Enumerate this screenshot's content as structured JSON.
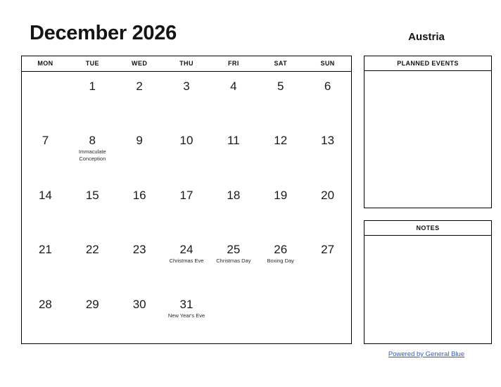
{
  "header": {
    "title": "December 2026",
    "country": "Austria"
  },
  "calendar": {
    "weekdays": [
      "MON",
      "TUE",
      "WED",
      "THU",
      "FRI",
      "SAT",
      "SUN"
    ],
    "weeks": [
      [
        {
          "day": "",
          "event": ""
        },
        {
          "day": "1",
          "event": ""
        },
        {
          "day": "2",
          "event": ""
        },
        {
          "day": "3",
          "event": ""
        },
        {
          "day": "4",
          "event": ""
        },
        {
          "day": "5",
          "event": ""
        },
        {
          "day": "6",
          "event": ""
        }
      ],
      [
        {
          "day": "7",
          "event": ""
        },
        {
          "day": "8",
          "event": "Immaculate Conception"
        },
        {
          "day": "9",
          "event": ""
        },
        {
          "day": "10",
          "event": ""
        },
        {
          "day": "11",
          "event": ""
        },
        {
          "day": "12",
          "event": ""
        },
        {
          "day": "13",
          "event": ""
        }
      ],
      [
        {
          "day": "14",
          "event": ""
        },
        {
          "day": "15",
          "event": ""
        },
        {
          "day": "16",
          "event": ""
        },
        {
          "day": "17",
          "event": ""
        },
        {
          "day": "18",
          "event": ""
        },
        {
          "day": "19",
          "event": ""
        },
        {
          "day": "20",
          "event": ""
        }
      ],
      [
        {
          "day": "21",
          "event": ""
        },
        {
          "day": "22",
          "event": ""
        },
        {
          "day": "23",
          "event": ""
        },
        {
          "day": "24",
          "event": "Christmas Eve"
        },
        {
          "day": "25",
          "event": "Christmas Day"
        },
        {
          "day": "26",
          "event": "Boxing Day"
        },
        {
          "day": "27",
          "event": ""
        }
      ],
      [
        {
          "day": "28",
          "event": ""
        },
        {
          "day": "29",
          "event": ""
        },
        {
          "day": "30",
          "event": ""
        },
        {
          "day": "31",
          "event": "New Year's Eve"
        },
        {
          "day": "",
          "event": ""
        },
        {
          "day": "",
          "event": ""
        },
        {
          "day": "",
          "event": ""
        }
      ]
    ]
  },
  "panels": {
    "planned_events": {
      "title": "PLANNED EVENTS",
      "content": ""
    },
    "notes": {
      "title": "NOTES",
      "content": ""
    }
  },
  "footer": {
    "link_text": "Powered by General Blue",
    "link_color": "#2b5bd7"
  }
}
